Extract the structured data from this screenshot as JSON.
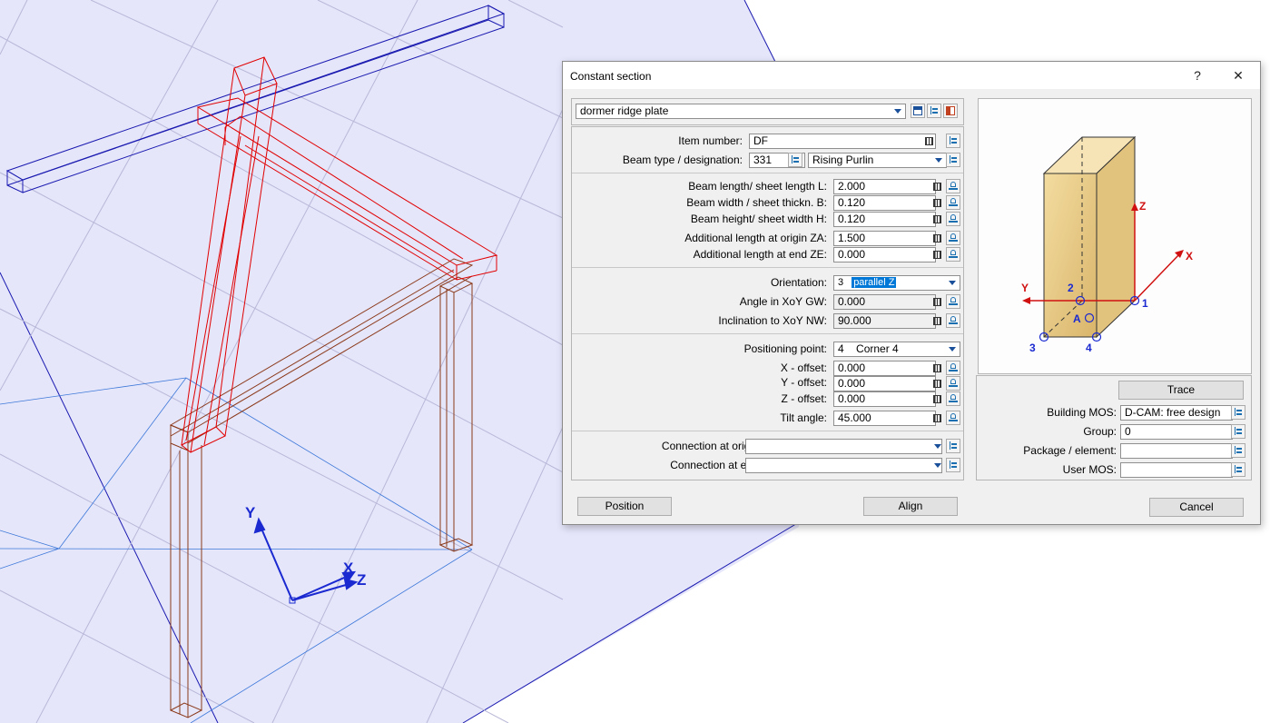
{
  "viewport": {
    "axis_labels": {
      "y": "Y",
      "x": "X",
      "z": "Z"
    },
    "colors": {
      "background": "#e6e6fb",
      "grid": "#b8b8d8",
      "selected_beam": "#e00000",
      "ridge_beam": "#1a1ab0",
      "frame": "#8b3a1a",
      "axes": "#1a2ad0"
    }
  },
  "dialog": {
    "title": "Constant section",
    "help_label": "?",
    "close_label": "✕",
    "template": {
      "value": "dormer ridge plate"
    },
    "item_number": {
      "label": "Item number:",
      "value": "DF"
    },
    "beam_type": {
      "label": "Beam type / designation:",
      "code": "331",
      "designation": "Rising Purlin"
    },
    "dimensions": [
      {
        "label": "Beam length/ sheet length L:",
        "value": "2.000"
      },
      {
        "label": "Beam width / sheet thickn. B:",
        "value": "0.120"
      },
      {
        "label": "Beam height/ sheet width H:",
        "value": "0.120"
      }
    ],
    "additional": [
      {
        "label": "Additional length at origin ZA:",
        "value": "1.500"
      },
      {
        "label": "Additional length at end ZE:",
        "value": "0.000"
      }
    ],
    "orientation": {
      "label": "Orientation:",
      "code": "3",
      "value": "parallel Z"
    },
    "angle_xoy": {
      "label": "Angle in XoY GW:",
      "value": "0.000"
    },
    "inclination": {
      "label": "Inclination to XoY NW:",
      "value": "90.000"
    },
    "positioning_point": {
      "label": "Positioning point:",
      "code": "4",
      "value": "Corner 4"
    },
    "offsets": [
      {
        "label": "X - offset:",
        "value": "0.000"
      },
      {
        "label": "Y - offset:",
        "value": "0.000"
      },
      {
        "label": "Z - offset:",
        "value": "0.000"
      }
    ],
    "tilt": {
      "label": "Tilt angle:",
      "value": "45.000"
    },
    "connection_origin": {
      "label": "Connection at origin:",
      "value": ""
    },
    "connection_end": {
      "label": "Connection at end:",
      "value": ""
    },
    "preview_labels": {
      "z": "Z",
      "x": "X",
      "y": "Y",
      "a": "A",
      "p1": "1",
      "p2": "2",
      "p3": "3",
      "p4": "4"
    },
    "trace_label": "Trace",
    "building_mos": {
      "label": "Building MOS:",
      "value": "D-CAM: free design"
    },
    "group": {
      "label": "Group:",
      "value": "0"
    },
    "package": {
      "label": "Package / element:",
      "value": ""
    },
    "user_mos": {
      "label": "User MOS:",
      "value": ""
    },
    "buttons": {
      "position": "Position",
      "align": "Align",
      "cancel": "Cancel"
    }
  }
}
